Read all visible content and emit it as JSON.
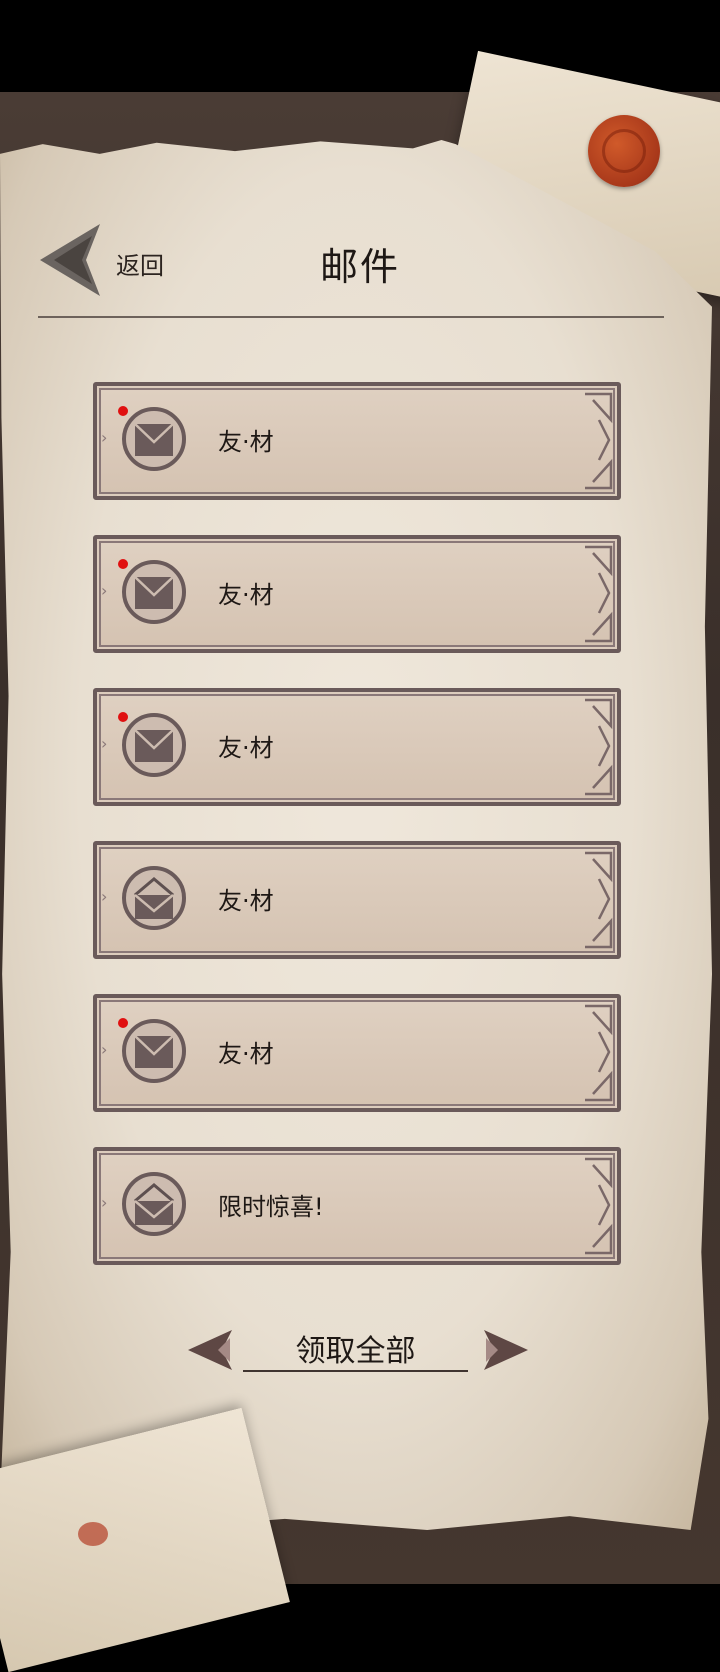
{
  "header": {
    "back_label": "返回",
    "title": "邮件"
  },
  "mails": [
    {
      "label": "友·材",
      "unread": true,
      "icon": "envelope-closed-icon"
    },
    {
      "label": "友·材",
      "unread": true,
      "icon": "envelope-closed-icon"
    },
    {
      "label": "友·材",
      "unread": true,
      "icon": "envelope-closed-icon"
    },
    {
      "label": "友·材",
      "unread": false,
      "icon": "envelope-open-icon"
    },
    {
      "label": "友·材",
      "unread": true,
      "icon": "envelope-closed-icon"
    },
    {
      "label": "限时惊喜!",
      "unread": false,
      "icon": "envelope-open-icon"
    }
  ],
  "footer": {
    "claim_all_label": "领取全部"
  },
  "colors": {
    "frame": "#6a5a5a",
    "unread_dot": "#e01010",
    "seal": "#b8441c"
  }
}
